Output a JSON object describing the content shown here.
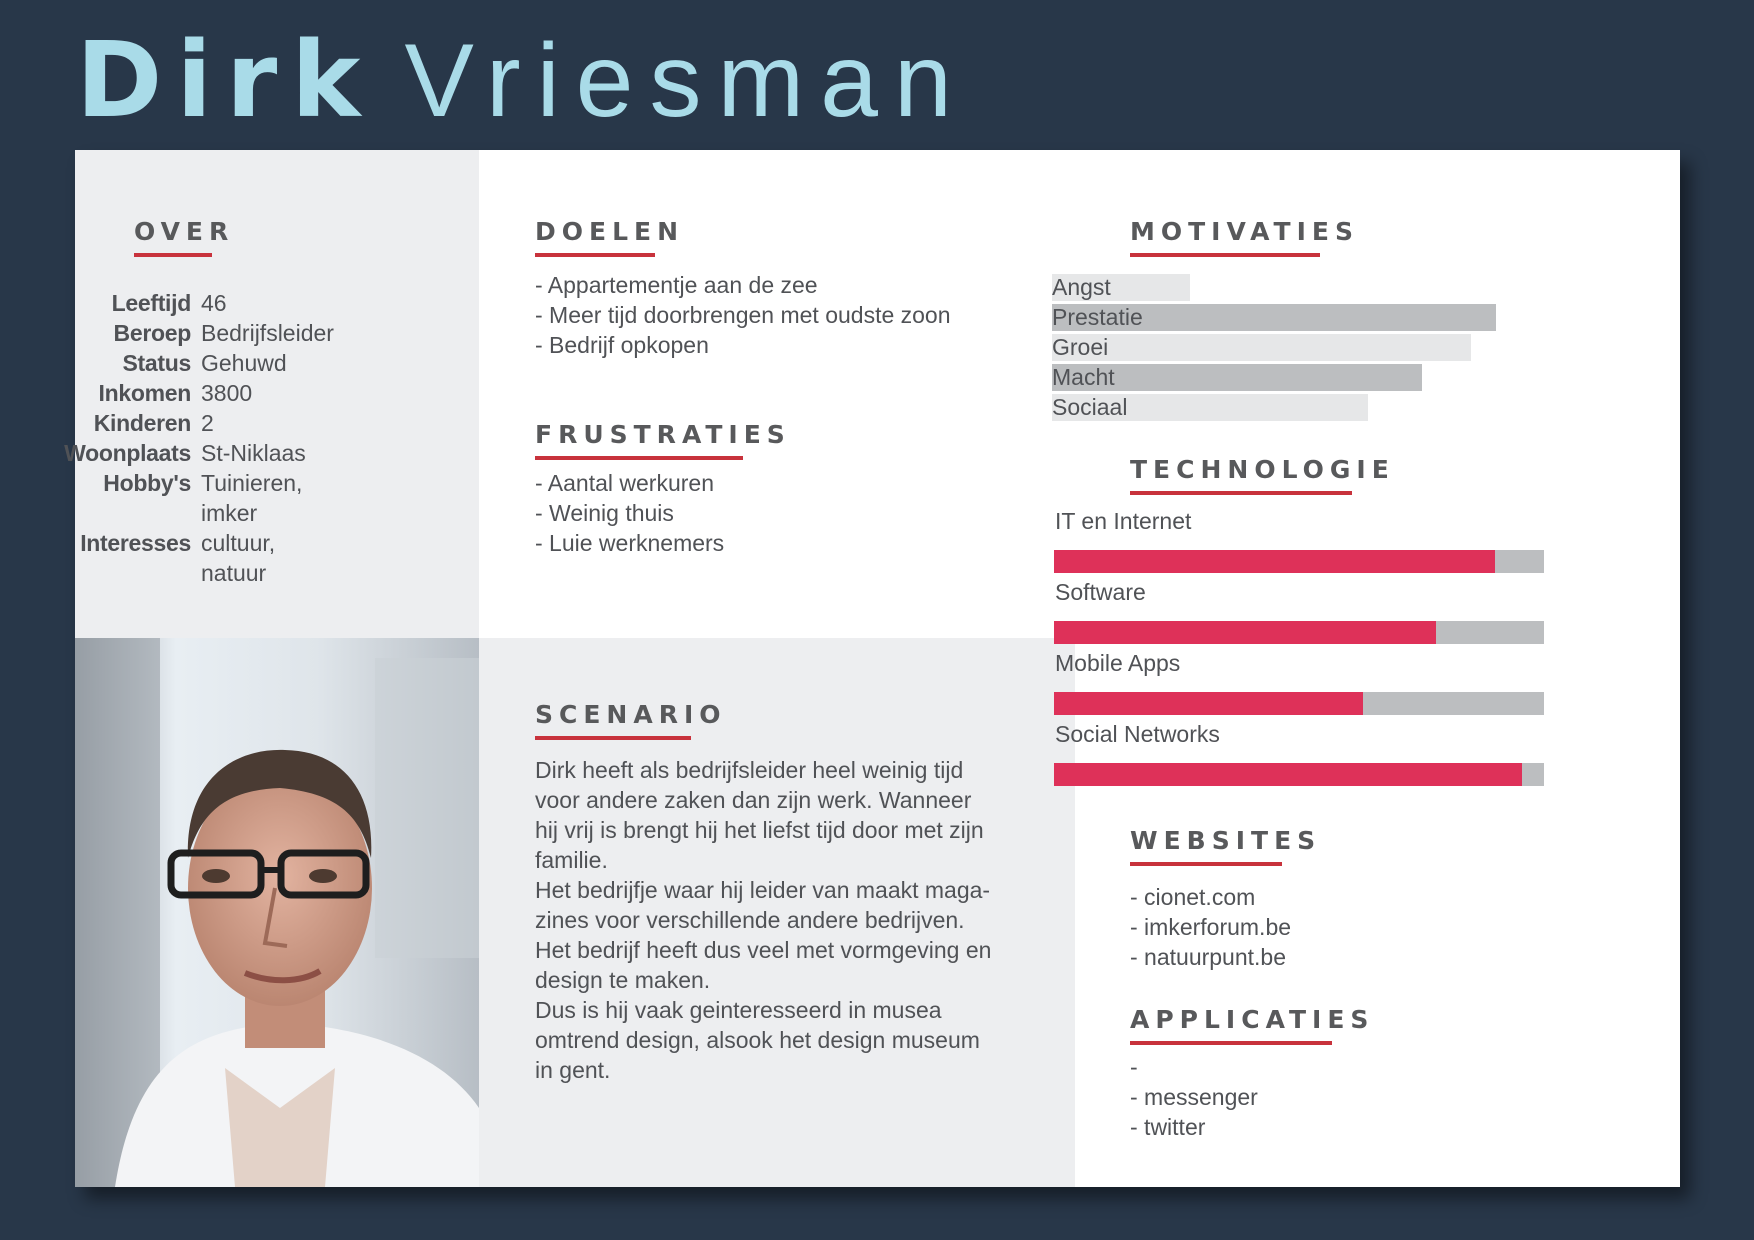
{
  "name": {
    "first": "Dirk",
    "last": "Vriesman"
  },
  "colors": {
    "page_bg": "#283749",
    "title": "#a9dbe8",
    "accent_red": "#c8323c",
    "tech_fill": "#de3159",
    "tech_track": "#bcbec0",
    "panel_gray": "#edeef0"
  },
  "about": {
    "title": "OVER",
    "rows": [
      {
        "label": "Leeftijd",
        "value": "46"
      },
      {
        "label": "Beroep",
        "value": "Bedrijfsleider"
      },
      {
        "label": "Status",
        "value": "Gehuwd"
      },
      {
        "label": "Inkomen",
        "value": "3800"
      },
      {
        "label": "Kinderen",
        "value": "2"
      },
      {
        "label": "Woonplaats",
        "value": "St-Niklaas"
      },
      {
        "label": "Hobby's",
        "value": "Tuinieren,\nimker"
      },
      {
        "label": "Interesses",
        "value": "cultuur,\nnatuur"
      }
    ]
  },
  "goals": {
    "title": "DOELEN",
    "items": [
      "- Appartementje aan de zee",
      "- Meer tijd doorbrengen met oudste zoon",
      "- Bedrijf opkopen"
    ]
  },
  "frustrations": {
    "title": "FRUSTRATIES",
    "items": [
      "- Aantal werkuren",
      "- Weinig thuis",
      "- Luie werknemers"
    ]
  },
  "scenario": {
    "title": "SCENARIO",
    "paragraphs": [
      "Dirk heeft als bedrijfsleider heel weinig tijd voor andere zaken dan zijn werk. Wanneer hij vrij is brengt hij het liefst tijd door met zijn familie.",
      "Het bedrijfje waar hij leider van maakt maga-zines voor verschillende andere bedrijven.",
      "Het bedrijf heeft dus veel met vormgeving en design te maken.",
      "Dus is hij vaak geinteresseerd in musea omtrend design, alsook het design museum in gent."
    ]
  },
  "motivations": {
    "title": "MOTIVATIES",
    "items": [
      {
        "label": "Angst",
        "level": 0.28,
        "shade": "#e6e7e8"
      },
      {
        "label": "Prestatie",
        "level": 0.9,
        "shade": "#bcbec0"
      },
      {
        "label": "Groei",
        "level": 0.85,
        "shade": "#e6e7e8"
      },
      {
        "label": "Macht",
        "level": 0.75,
        "shade": "#bcbec0"
      },
      {
        "label": "Sociaal",
        "level": 0.64,
        "shade": "#e6e7e8"
      }
    ]
  },
  "technology": {
    "title": "TECHNOLOGIE",
    "items": [
      {
        "label": "IT en Internet",
        "level": 0.9
      },
      {
        "label": "Software",
        "level": 0.78
      },
      {
        "label": "Mobile Apps",
        "level": 0.63
      },
      {
        "label": "Social Networks",
        "level": 0.955
      }
    ]
  },
  "websites": {
    "title": "WEBSITES",
    "items": [
      "- cionet.com",
      "- imkerforum.be",
      "- natuurpunt.be"
    ]
  },
  "applications": {
    "title": "APPLICATIES",
    "items": [
      "-",
      "- messenger",
      "- twitter"
    ]
  }
}
